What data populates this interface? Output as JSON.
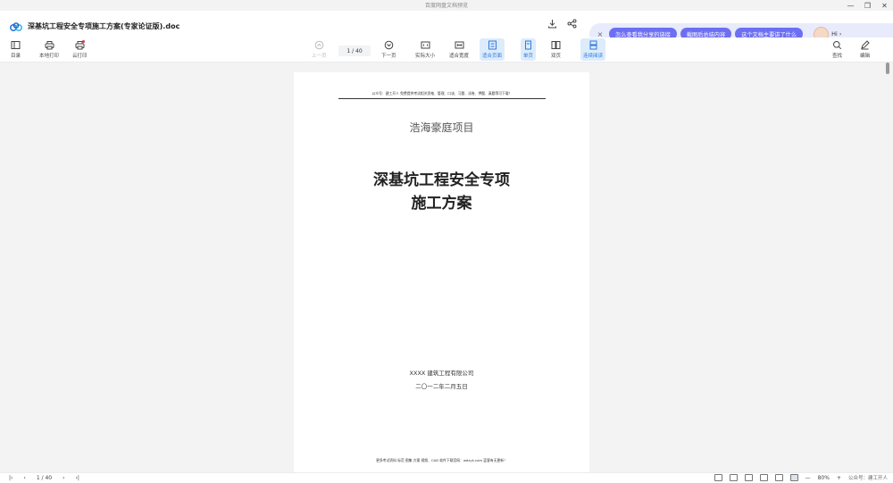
{
  "window": {
    "title": "百度网盘文档预览",
    "minimize": "—",
    "restore": "❐",
    "close": "✕"
  },
  "tab": {
    "filename": "深基坑工程安全专项施工方案(专家论证版).doc"
  },
  "ai_bar": {
    "close": "×",
    "suggestions": [
      "怎么查看我分享的链接",
      "截图后总结内容",
      "这个文档主要讲了什么"
    ],
    "hi": "Hi ›"
  },
  "toolbar": {
    "toc": "目录",
    "local_print": "本地打印",
    "cloud_print": "云打印",
    "prev": "上一页",
    "page_indicator": "1 / 40",
    "next": "下一页",
    "actual_size": "实际大小",
    "fit_width": "适合宽度",
    "fit_page": "适合页面",
    "single_page": "单页",
    "double_page": "双页",
    "continuous": "连续阅读",
    "find": "查找",
    "edit": "编辑"
  },
  "document": {
    "header_line": "公众号：建工开人 免费提供考试相关资格、管理、口诀、习题、试卷、押题、真题等可下载！",
    "project": "浩海豪庭项目",
    "title_line1": "深基坑工程安全专项",
    "title_line2": "施工方案",
    "company": "XXXX 建筑工程有限公司",
    "date": "二〇一二年二月五日",
    "footer": "更多考试资料 标范 图集 方案 视频、CAD 软件下载官网：wdzyk.com 蓝客有无更新！"
  },
  "bottom": {
    "first": "|‹",
    "prev": "‹",
    "page": "1 / 40",
    "next": "›",
    "last": "›|",
    "zoom_minus": "—",
    "zoom": "80%",
    "zoom_plus": "+",
    "watermark": "公众号：建工开人"
  },
  "colors": {
    "accent": "#2a7bde",
    "pill": "#6d6ff3",
    "ai_bg": "#e8ebfb",
    "badge": "#e0344a"
  }
}
